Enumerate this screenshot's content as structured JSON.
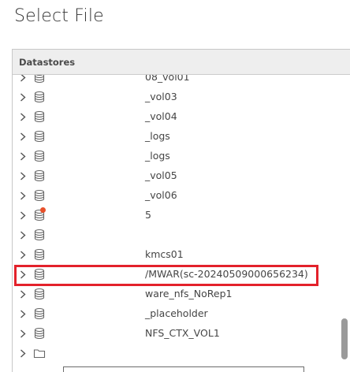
{
  "dialog": {
    "title": "Select File"
  },
  "panel": {
    "header": "Datastores"
  },
  "rows": [
    {
      "label": "08_vol01",
      "icon": "datastore-icon"
    },
    {
      "label": "_vol03",
      "icon": "datastore-icon"
    },
    {
      "label": "_vol04",
      "icon": "datastore-icon"
    },
    {
      "label": "_logs",
      "icon": "datastore-icon"
    },
    {
      "label": "_logs",
      "icon": "datastore-icon"
    },
    {
      "label": "_vol05",
      "icon": "datastore-icon"
    },
    {
      "label": "_vol06",
      "icon": "datastore-icon"
    },
    {
      "label": "5",
      "icon": "datastore-warning-icon"
    },
    {
      "label": "",
      "icon": "datastore-icon"
    },
    {
      "label": "kmcs01",
      "icon": "datastore-icon"
    },
    {
      "label": "/MWAR(sc-20240509000656234)",
      "icon": "datastore-icon",
      "highlighted": true
    },
    {
      "label": "ware_nfs_NoRep1",
      "icon": "datastore-icon"
    },
    {
      "label": "_placeholder",
      "icon": "datastore-icon"
    },
    {
      "label": "NFS_CTX_VOL1",
      "icon": "datastore-icon"
    },
    {
      "label": "",
      "icon": "folder-icon"
    }
  ],
  "colors": {
    "highlight": "#e3212b",
    "warning": "#e8502a"
  }
}
